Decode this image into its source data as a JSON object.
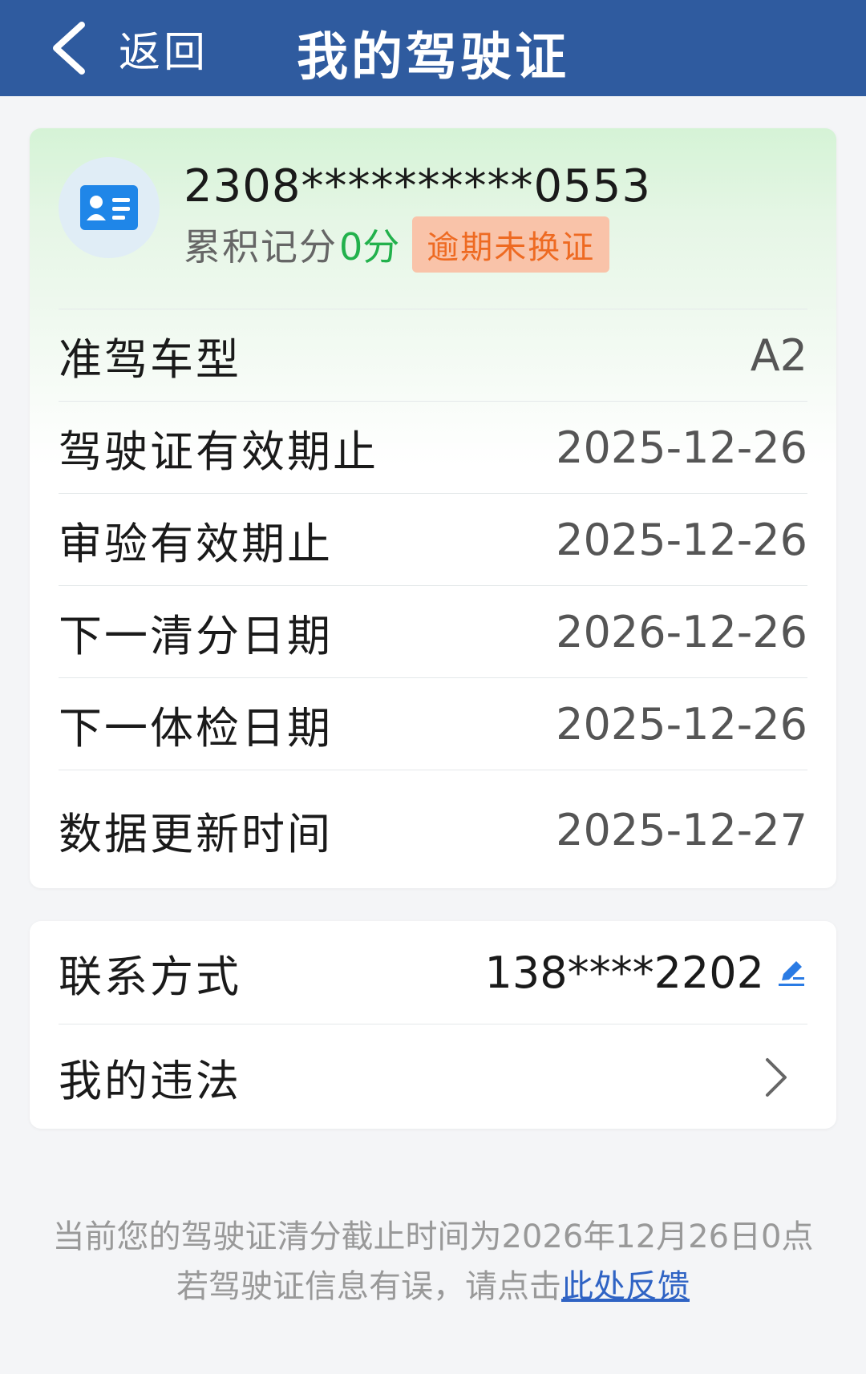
{
  "header": {
    "back_label": "返回",
    "title": "我的驾驶证"
  },
  "license": {
    "id_number": "2308**********0553",
    "points_label": "累积记分",
    "points_value": "0分",
    "status_badge": "逾期未换证"
  },
  "details": [
    {
      "label": "准驾车型",
      "value": "A2"
    },
    {
      "label": "驾驶证有效期止",
      "value": "2025-12-26"
    },
    {
      "label": "审验有效期止",
      "value": "2025-12-26"
    },
    {
      "label": "下一清分日期",
      "value": "2026-12-26"
    },
    {
      "label": "下一体检日期",
      "value": "2025-12-26"
    },
    {
      "label": "数据更新时间",
      "value": "2025-12-27"
    }
  ],
  "contact": {
    "label": "联系方式",
    "value": "138****2202"
  },
  "violations": {
    "label": "我的违法"
  },
  "footer": {
    "notice": "当前您的驾驶证清分截止时间为2026年12月26日0点",
    "feedback_prefix": "若驾驶证信息有误，请点击",
    "feedback_link": "此处反馈"
  },
  "colors": {
    "header_bg": "#2f5b9f",
    "points_green": "#22b14c",
    "badge_bg": "#f9c3a9",
    "badge_text": "#ee6a22",
    "link_blue": "#2f63c4"
  },
  "icons": [
    "chevron-left-icon",
    "id-card-icon",
    "edit-icon",
    "chevron-right-icon"
  ]
}
